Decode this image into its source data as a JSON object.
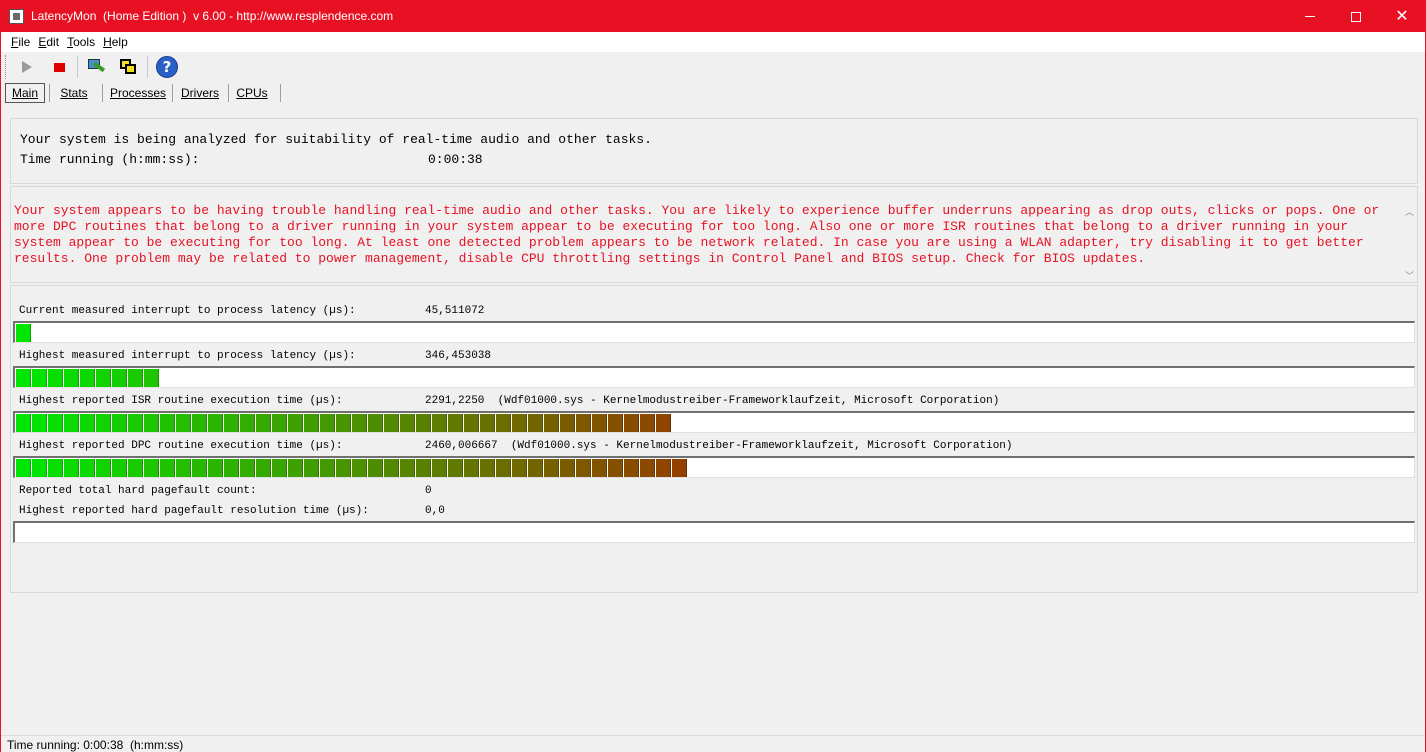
{
  "window": {
    "title": "LatencyMon  (Home Edition )  v 6.00 - http://www.resplendence.com",
    "accent_color": "#e81123"
  },
  "menu": {
    "items": [
      {
        "label": "File",
        "key": "F",
        "rest": "ile"
      },
      {
        "label": "Edit",
        "key": "E",
        "rest": "dit"
      },
      {
        "label": "Tools",
        "key": "T",
        "rest": "ools"
      },
      {
        "label": "Help",
        "key": "H",
        "rest": "elp"
      }
    ]
  },
  "toolbar": {
    "icons": [
      "play-icon",
      "stop-icon",
      "tools-icon",
      "windows-icon",
      "help-icon"
    ],
    "help_glyph": "?"
  },
  "tabs": [
    {
      "label": "Main",
      "active": true
    },
    {
      "label": "Stats",
      "active": false
    },
    {
      "label": "Processes",
      "active": false
    },
    {
      "label": "Drivers",
      "active": false
    },
    {
      "label": "CPUs",
      "active": false
    }
  ],
  "summary": {
    "line1": "Your system is being analyzed for suitability of real-time audio and other tasks.",
    "time_label": "Time running (h:mm:ss):",
    "time_value": "0:00:38"
  },
  "warning": {
    "text": "Your system appears to be having trouble handling real-time audio and other tasks. You are likely to experience buffer underruns appearing as drop outs, clicks or pops. One or more DPC routines that belong to a driver running in your system appear to be executing for too long. Also one or more ISR routines that belong to a driver running in your system appear to be executing for too long. At least one detected problem appears to be network related. In case you are using a WLAN adapter, try disabling it to get better results. One problem may be related to power management, disable CPU throttling settings in Control Panel and BIOS setup. Check for BIOS updates.",
    "color": "#e81123"
  },
  "stats": {
    "current_latency": {
      "label": "Current measured interrupt to process latency (µs):",
      "value": "45,511072",
      "level_segments": 1
    },
    "highest_latency": {
      "label": "Highest measured interrupt to process latency (µs):",
      "value": "346,453038",
      "level_segments": 9
    },
    "isr_time": {
      "label": "Highest reported ISR routine execution time (µs):",
      "value": "2291,2250  (Wdf01000.sys - Kernelmodustreiber-Frameworklaufzeit, Microsoft Corporation)",
      "level_segments": 41
    },
    "dpc_time": {
      "label": "Highest reported DPC routine execution time (µs):",
      "value": "2460,006667  (Wdf01000.sys - Kernelmodustreiber-Frameworklaufzeit, Microsoft Corporation)",
      "level_segments": 42
    },
    "pagefault_count": {
      "label": "Reported total hard pagefault count:",
      "value": "0"
    },
    "pagefault_time": {
      "label": "Highest reported hard pagefault resolution time (µs):",
      "value": "0,0",
      "level_segments": 0
    }
  },
  "statusbar": {
    "text": "Time running: 0:00:38  (h:mm:ss)"
  }
}
